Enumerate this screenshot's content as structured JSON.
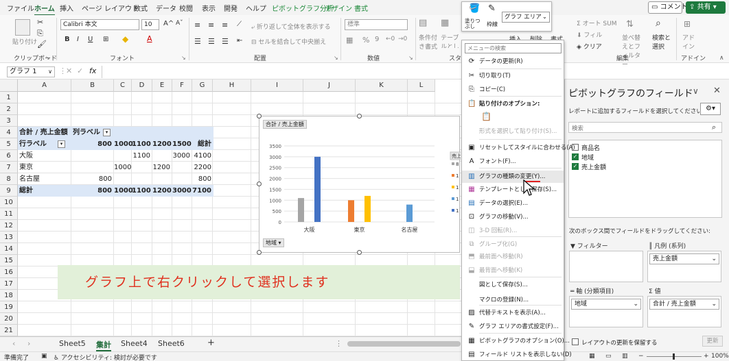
{
  "ribbon_tabs": [
    "ファイル",
    "ホーム",
    "挿入",
    "ページ レイアウト",
    "数式",
    "データ",
    "校閲",
    "表示",
    "開発",
    "ヘルプ",
    "ピボットグラフ分析",
    "デザイン",
    "書式"
  ],
  "header_buttons": {
    "comment": "コメント",
    "share": "共有"
  },
  "ribbon": {
    "groups": {
      "clipboard": "クリップボード",
      "font": "フォント",
      "alignment": "配置",
      "number": "数値",
      "style": "スタイ",
      "edit": "編集",
      "addin": "アドイン"
    },
    "paste": "貼り付け",
    "font_name": "Calibri 本文",
    "font_size": "10",
    "wrap_text": "折り返して全体を表示する",
    "merge_center": "セルを結合して中央揃え",
    "number_format": "標準",
    "cond_format": "条件付き書式",
    "table_format": "テーブルとして書式設定",
    "cell_style": "セルの",
    "insert": "挿入",
    "delete": "削除",
    "format": "書式",
    "autosum": "オート SUM",
    "fill": "フィル",
    "clear": "クリア",
    "sort_filter": "並べ替えとフィルター",
    "find_select": "検索と選択",
    "addin_btn": "アドイン"
  },
  "mini_toolbar": {
    "fill": "塗りつぶし",
    "outline": "枠線",
    "element": "グラフ エリア"
  },
  "formula_bar": {
    "name_box": "グラフ 1",
    "fx": "fx"
  },
  "grid": {
    "columns": [
      "A",
      "B",
      "C",
      "D",
      "E",
      "F",
      "G",
      "H",
      "I",
      "J",
      "K",
      "L"
    ],
    "rows": [
      "1",
      "2",
      "3",
      "4",
      "5",
      "6",
      "7",
      "8",
      "9",
      "10",
      "11",
      "12",
      "13",
      "14",
      "15",
      "16",
      "17",
      "18",
      "19",
      "20",
      "21"
    ]
  },
  "pivot": {
    "header_label": "合計 / 売上金額",
    "column_label": "列ラベル",
    "row_label": "行ラベル",
    "columns": [
      "800",
      "1000",
      "1100",
      "1200",
      "1500",
      "総計"
    ],
    "rows": [
      {
        "name": "大阪",
        "cells": [
          "",
          "",
          "1100",
          "",
          "3000",
          "4100"
        ]
      },
      {
        "name": "東京",
        "cells": [
          "",
          "1000",
          "",
          "1200",
          "",
          "2200"
        ]
      },
      {
        "name": "名古屋",
        "cells": [
          "800",
          "",
          "",
          "",
          "",
          "800"
        ]
      }
    ],
    "total": {
      "name": "総計",
      "cells": [
        "800",
        "1000",
        "1100",
        "1200",
        "3000",
        "7100"
      ]
    }
  },
  "chart_data": {
    "type": "bar",
    "value_button": "合計 / 売上金額",
    "axis_button": "地域",
    "legend_title": "売上",
    "categories": [
      "大阪",
      "東京",
      "名古屋"
    ],
    "ylim": [
      0,
      3500
    ],
    "yticks": [
      "0",
      "500",
      "1000",
      "1500",
      "2000",
      "2500",
      "3000",
      "3500"
    ],
    "series": [
      {
        "color": "#a5a5a5",
        "values": [
          1100,
          0,
          0
        ]
      },
      {
        "color": "#ed7d31",
        "values": [
          0,
          1000,
          0
        ]
      },
      {
        "color": "#ffc000",
        "values": [
          0,
          1200,
          0
        ]
      },
      {
        "color": "#5b9bd5",
        "values": [
          0,
          0,
          800
        ]
      },
      {
        "color": "#4472c4",
        "values": [
          3000,
          0,
          0
        ]
      }
    ],
    "legend_stubs": [
      "8",
      "1",
      "1",
      "1",
      "1"
    ]
  },
  "banner": "グラフ上で右クリックして選択します",
  "context_menu": {
    "search": "メニューの検索",
    "items": [
      {
        "label": "データの更新(R)",
        "icon": "refresh-icon",
        "disabled": false
      },
      {
        "label": "切り取り(T)",
        "icon": "scissors-icon",
        "disabled": false
      },
      {
        "label": "コピー(C)",
        "icon": "copy-icon",
        "disabled": false
      },
      {
        "label": "貼り付けのオプション:",
        "icon": "paste-icon",
        "disabled": false
      },
      {
        "label": "形式を選択して貼り付け(S)...",
        "icon": "",
        "disabled": true
      },
      {
        "label": "リセットしてスタイルに合わせる(A)",
        "icon": "reset-icon",
        "disabled": false
      },
      {
        "label": "フォント(F)...",
        "icon": "font-icon",
        "disabled": false
      },
      {
        "label": "グラフの種類の変更(Y)...",
        "icon": "chart-type-icon",
        "disabled": false
      },
      {
        "label": "テンプレートとして保存(S)...",
        "icon": "template-icon",
        "disabled": false
      },
      {
        "label": "データの選択(E)...",
        "icon": "select-data-icon",
        "disabled": false
      },
      {
        "label": "グラフの移動(V)...",
        "icon": "move-chart-icon",
        "disabled": false
      },
      {
        "label": "3-D 回転(R)...",
        "icon": "rotate-3d-icon",
        "disabled": true
      },
      {
        "label": "グループ化(G)",
        "icon": "group-icon",
        "disabled": true
      },
      {
        "label": "最前面へ移動(R)",
        "icon": "bring-front-icon",
        "disabled": true
      },
      {
        "label": "最背面へ移動(K)",
        "icon": "send-back-icon",
        "disabled": true
      },
      {
        "label": "図として保存(S)...",
        "icon": "",
        "disabled": false
      },
      {
        "label": "マクロの登録(N)...",
        "icon": "",
        "disabled": false
      },
      {
        "label": "代替テキストを表示(A)...",
        "icon": "alt-text-icon",
        "disabled": false
      },
      {
        "label": "グラフ エリアの書式設定(F)...",
        "icon": "format-area-icon",
        "disabled": false
      },
      {
        "label": "ピボットグラフのオプション(O)...",
        "icon": "pivot-options-icon",
        "disabled": false
      },
      {
        "label": "フィールド リストを表示しない(D)",
        "icon": "field-list-icon",
        "disabled": false
      }
    ]
  },
  "pane": {
    "title": "ピボットグラフのフィールド",
    "subtitle": "レポートに追加するフィールドを選択してください:",
    "search_placeholder": "検索",
    "fields": [
      {
        "label": "商品名",
        "checked": false
      },
      {
        "label": "地域",
        "checked": true
      },
      {
        "label": "売上金額",
        "checked": true
      }
    ],
    "drag_hint": "次のボックス間でフィールドをドラッグしてください:",
    "filter_label": "フィルター",
    "legend_label": "凡例 (系列)",
    "legend_value": "売上金額",
    "axis_label": "軸 (分類項目)",
    "axis_value": "地域",
    "values_label": "値",
    "values_value": "合計 / 売上金額",
    "defer_label": "レイアウトの更新を保留する",
    "update_button": "更新"
  },
  "sheet_tabs": [
    "Sheet5",
    "集計",
    "Sheet4",
    "Sheet6"
  ],
  "active_sheet": "集計",
  "status": {
    "ready": "準備完了",
    "accessibility": "アクセシビリティ: 検討が必要です",
    "zoom": "100%"
  }
}
